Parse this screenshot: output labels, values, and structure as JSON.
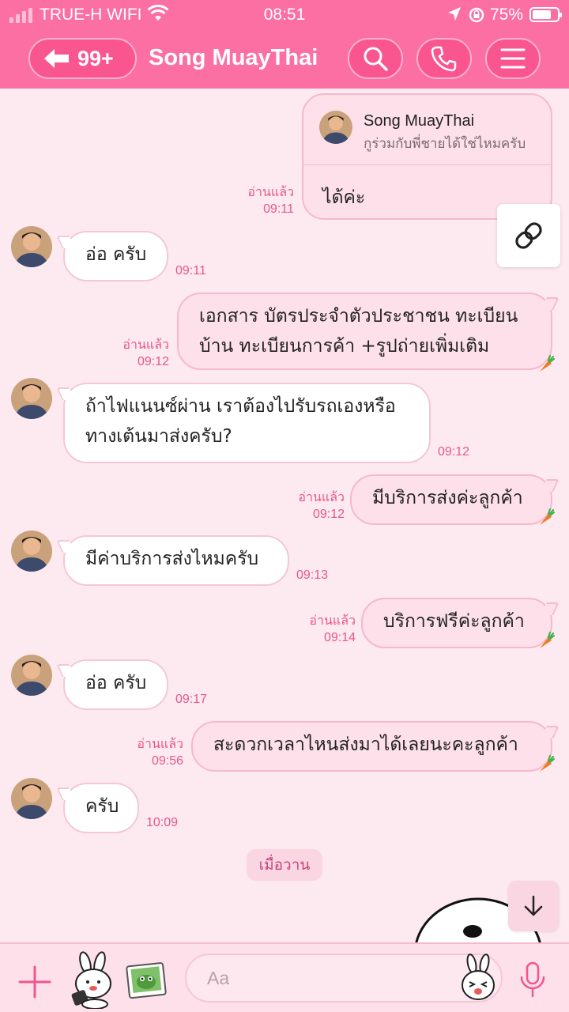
{
  "status_bar": {
    "carrier": "TRUE-H WIFI",
    "time": "08:51",
    "battery": "75%",
    "battery_level": 0.75
  },
  "header": {
    "back_count": "99+",
    "title": "Song MuayThai",
    "icons": [
      "back-arrow-icon",
      "search-icon",
      "phone-icon",
      "menu-icon"
    ]
  },
  "reply_card": {
    "quoted_name": "Song MuayThai",
    "quoted_text": "กูร่วมกับพี่ชายได้ใช่ไหมครับ",
    "reply_text": "ได้ค่ะ",
    "read": "อ่านแล้ว",
    "time": "09:11"
  },
  "messages": [
    {
      "direction": "in",
      "lines": [
        "อ่อ ครับ"
      ],
      "time": "09:11"
    },
    {
      "direction": "out",
      "lines": [
        "เอกสาร บัตรประจำตัวประชาชน ทะเบียน",
        "บ้าน ทะเบียนการค้า +รูปถ่ายเพิ่มเติม"
      ],
      "read": "อ่านแล้ว",
      "time": "09:12"
    },
    {
      "direction": "in",
      "lines": [
        "ถ้าไฟแนนซ์ผ่าน เราต้องไปรับรถเองหรือ",
        "ทางเต้นมาส่งครับ?"
      ],
      "time": "09:12"
    },
    {
      "direction": "out",
      "lines": [
        "มีบริการส่งค่ะลูกค้า"
      ],
      "read": "อ่านแล้ว",
      "time": "09:12"
    },
    {
      "direction": "in",
      "lines": [
        "มีค่าบริการส่งไหมครับ"
      ],
      "time": "09:13"
    },
    {
      "direction": "out",
      "lines": [
        "บริการฟรีค่ะลูกค้า"
      ],
      "read": "อ่านแล้ว",
      "time": "09:14"
    },
    {
      "direction": "in",
      "lines": [
        "อ่อ ครับ"
      ],
      "time": "09:17"
    },
    {
      "direction": "out",
      "lines": [
        "สะดวกเวลาไหนส่งมาได้เลยนะคะลูกค้า"
      ],
      "read": "อ่านแล้ว",
      "time": "09:56"
    },
    {
      "direction": "in",
      "lines": [
        "ครับ"
      ],
      "time": "10:09"
    }
  ],
  "date_separator": "เมื่อวาน",
  "input": {
    "placeholder": "Aa"
  },
  "colors": {
    "header_pink": "#fb6fa3",
    "background": "#fdeaf0",
    "outgoing_bubble": "#fde0ea",
    "read_text": "#e8568a"
  }
}
